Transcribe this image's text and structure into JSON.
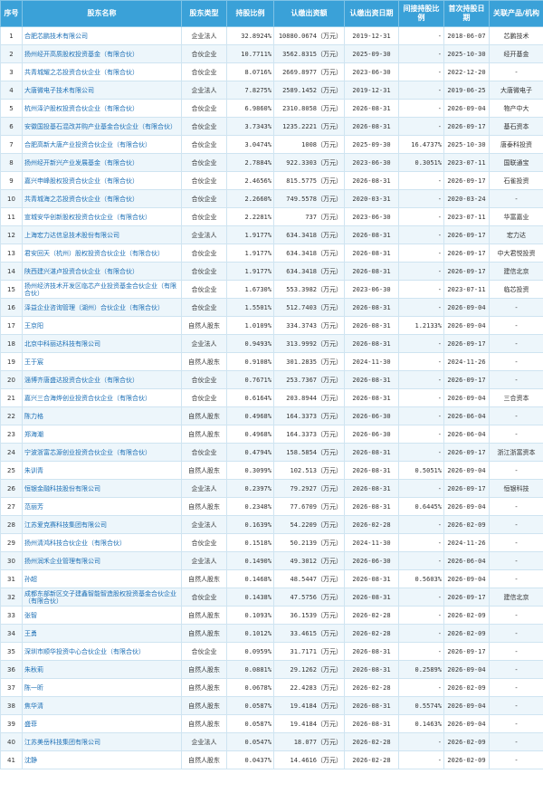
{
  "columns": [
    "序号",
    "股东名称",
    "股东类型",
    "持股比例",
    "认缴出资额",
    "认缴出资日期",
    "间接持股比例",
    "首次持股日期",
    "关联产品/机构"
  ],
  "rows": [
    [
      "1",
      "合肥芯鹏技术有限公司",
      "企业法人",
      "32.8924%",
      "10880.0674（万元）",
      "2019-12-31",
      "-",
      "2018-06-07",
      "芯鹏技术"
    ],
    [
      "2",
      "扬州经开高质股权投资基金（有限合伙）",
      "合伙企业",
      "10.7711%",
      "3562.8315（万元）",
      "2025-09-30",
      "-",
      "2025-10-30",
      "经开基金"
    ],
    [
      "3",
      "共青城耀之芯投资合伙企业（有限合伙）",
      "合伙企业",
      "8.0716%",
      "2669.8977（万元）",
      "2023-06-30",
      "-",
      "2022-12-20",
      "-"
    ],
    [
      "4",
      "大唐微电子技术有限公司",
      "企业法人",
      "7.8275%",
      "2589.1452（万元）",
      "2019-12-31",
      "-",
      "2019-06-25",
      "大唐微电子"
    ],
    [
      "5",
      "杭州泽沪股权投资合伙企业（有限合伙）",
      "合伙企业",
      "6.9860%",
      "2310.8058（万元）",
      "2026-08-31",
      "-",
      "2026-09-04",
      "物产中大"
    ],
    [
      "6",
      "安徽国投基石混改并购产业基金合伙企业（有限合伙）",
      "合伙企业",
      "3.7343%",
      "1235.2221（万元）",
      "2026-08-31",
      "-",
      "2026-09-17",
      "基石资本"
    ],
    [
      "7",
      "合肥高新大唐产业投资合伙企业（有限合伙）",
      "合伙企业",
      "3.0474%",
      "1008（万元）",
      "2025-09-30",
      "16.4737%",
      "2025-10-30",
      "唐泰科投资"
    ],
    [
      "8",
      "扬州经开新兴产业发展基金（有限合伙）",
      "合伙企业",
      "2.7884%",
      "922.3303（万元）",
      "2023-06-30",
      "0.3051%",
      "2023-07-11",
      "国联通宝"
    ],
    [
      "9",
      "嘉兴申峰股权投资合伙企业（有限合伙）",
      "合伙企业",
      "2.4656%",
      "815.5775（万元）",
      "2026-08-31",
      "-",
      "2026-09-17",
      "石雀投资"
    ],
    [
      "10",
      "共青城海之芯投资合伙企业（有限合伙）",
      "合伙企业",
      "2.2660%",
      "749.5578（万元）",
      "2020-03-31",
      "-",
      "2020-03-24",
      "-"
    ],
    [
      "11",
      "宣城安华创新股权投资合伙企业（有限合伙）",
      "合伙企业",
      "2.2281%",
      "737（万元）",
      "2023-06-30",
      "-",
      "2023-07-11",
      "华富嘉业"
    ],
    [
      "12",
      "上海宏力达信息技术股份有限公司",
      "企业法人",
      "1.9177%",
      "634.3418（万元）",
      "2026-08-31",
      "-",
      "2026-09-17",
      "宏力达"
    ],
    [
      "13",
      "君安回天（杭州）股权投资合伙企业（有限合伙）",
      "合伙企业",
      "1.9177%",
      "634.3418（万元）",
      "2026-08-31",
      "-",
      "2026-09-17",
      "中大君悦投资"
    ],
    [
      "14",
      "陕西建兴湛卢投资合伙企业（有限合伙）",
      "合伙企业",
      "1.9177%",
      "634.3418（万元）",
      "2026-08-31",
      "-",
      "2026-09-17",
      "建信北京"
    ],
    [
      "15",
      "扬州经济技术开发区临芯产业投资基金合伙企业（有限合伙）",
      "合伙企业",
      "1.6730%",
      "553.3982（万元）",
      "2023-06-30",
      "-",
      "2023-07-11",
      "临芯投资"
    ],
    [
      "16",
      "泽益企业咨询管理（湖州）合伙企业（有限合伙）",
      "合伙企业",
      "1.5501%",
      "512.7403（万元）",
      "2026-08-31",
      "-",
      "2026-09-04",
      "-"
    ],
    [
      "17",
      "王京阳",
      "自然人股东",
      "1.0109%",
      "334.3743（万元）",
      "2026-08-31",
      "1.2133%",
      "2026-09-04",
      "-"
    ],
    [
      "18",
      "北京中科丽达科技有限公司",
      "企业法人",
      "0.9493%",
      "313.9992（万元）",
      "2026-08-31",
      "-",
      "2026-09-17",
      "-"
    ],
    [
      "19",
      "王于宸",
      "自然人股东",
      "0.9108%",
      "301.2835（万元）",
      "2024-11-30",
      "-",
      "2024-11-26",
      "-"
    ],
    [
      "20",
      "淄博齐唐盛达投资合伙企业（有限合伙）",
      "合伙企业",
      "0.7671%",
      "253.7367（万元）",
      "2026-08-31",
      "-",
      "2026-09-17",
      "-"
    ],
    [
      "21",
      "嘉兴三合海烨创业投资合伙企业（有限合伙）",
      "合伙企业",
      "0.6164%",
      "203.8944（万元）",
      "2026-08-31",
      "-",
      "2026-09-04",
      "三合资本"
    ],
    [
      "22",
      "陈力格",
      "自然人股东",
      "0.4968%",
      "164.3373（万元）",
      "2026-06-30",
      "-",
      "2026-06-04",
      "-"
    ],
    [
      "23",
      "郑海潮",
      "自然人股东",
      "0.4968%",
      "164.3373（万元）",
      "2026-06-30",
      "-",
      "2026-06-04",
      "-"
    ],
    [
      "24",
      "宁波浙富芯源创业投资合伙企业（有限合伙）",
      "合伙企业",
      "0.4794%",
      "158.5854（万元）",
      "2026-08-31",
      "-",
      "2026-09-17",
      "浙江浙富资本"
    ],
    [
      "25",
      "朱训青",
      "自然人股东",
      "0.3099%",
      "102.513（万元）",
      "2026-08-31",
      "0.5051%",
      "2026-09-04",
      "-"
    ],
    [
      "26",
      "恒银金融科技股份有限公司",
      "企业法人",
      "0.2397%",
      "79.2927（万元）",
      "2026-08-31",
      "-",
      "2026-09-17",
      "恒银科技"
    ],
    [
      "27",
      "范丽芳",
      "自然人股东",
      "0.2348%",
      "77.6709（万元）",
      "2026-08-31",
      "0.6445%",
      "2026-09-04",
      "-"
    ],
    [
      "28",
      "江苏爱克赛科技集团有限公司",
      "企业法人",
      "0.1639%",
      "54.2209（万元）",
      "2026-02-28",
      "-",
      "2026-02-09",
      "-"
    ],
    [
      "29",
      "扬州清鸿科技合伙企业（有限合伙）",
      "合伙企业",
      "0.1518%",
      "50.2139（万元）",
      "2024-11-30",
      "-",
      "2024-11-26",
      "-"
    ],
    [
      "30",
      "扬州润禾企业管理有限公司",
      "企业法人",
      "0.1490%",
      "49.3012（万元）",
      "2026-06-30",
      "-",
      "2026-06-04",
      "-"
    ],
    [
      "31",
      "孙超",
      "自然人股东",
      "0.1468%",
      "48.5447（万元）",
      "2026-08-31",
      "0.5603%",
      "2026-09-04",
      "-"
    ],
    [
      "32",
      "成都东部新区交子建鑫智能智造股权投资基金合伙企业（有限合伙）",
      "合伙企业",
      "0.1438%",
      "47.5756（万元）",
      "2026-08-31",
      "-",
      "2026-09-17",
      "建信北京"
    ],
    [
      "33",
      "张智",
      "自然人股东",
      "0.1093%",
      "36.1539（万元）",
      "2026-02-28",
      "-",
      "2026-02-09",
      "-"
    ],
    [
      "34",
      "王勇",
      "自然人股东",
      "0.1012%",
      "33.4615（万元）",
      "2026-02-28",
      "-",
      "2026-02-09",
      "-"
    ],
    [
      "35",
      "深圳市顺华投资中心合伙企业（有限合伙）",
      "合伙企业",
      "0.0959%",
      "31.7171（万元）",
      "2026-08-31",
      "-",
      "2026-09-17",
      "-"
    ],
    [
      "36",
      "朱秋莉",
      "自然人股东",
      "0.0881%",
      "29.1262（万元）",
      "2026-08-31",
      "0.2589%",
      "2026-09-04",
      "-"
    ],
    [
      "37",
      "陈一昕",
      "自然人股东",
      "0.0678%",
      "22.4283（万元）",
      "2026-02-28",
      "-",
      "2026-02-09",
      "-"
    ],
    [
      "38",
      "焦华清",
      "自然人股东",
      "0.0587%",
      "19.4184（万元）",
      "2026-08-31",
      "0.5574%",
      "2026-09-04",
      "-"
    ],
    [
      "39",
      "盛菲",
      "自然人股东",
      "0.0587%",
      "19.4184（万元）",
      "2026-08-31",
      "0.1463%",
      "2026-09-04",
      "-"
    ],
    [
      "40",
      "江苏美岳科技集团有限公司",
      "企业法人",
      "0.0547%",
      "18.077（万元）",
      "2026-02-28",
      "-",
      "2026-02-09",
      "-"
    ],
    [
      "41",
      "沈静",
      "自然人股东",
      "0.0437%",
      "14.4616（万元）",
      "2026-02-28",
      "-",
      "2026-02-09",
      "-"
    ]
  ],
  "colors": {
    "header_bg": "#3aa1d8",
    "header_text": "#ffffff",
    "name_link": "#1c6fb5",
    "row_alt": "#edf6fb",
    "border": "#cfe4f1"
  }
}
